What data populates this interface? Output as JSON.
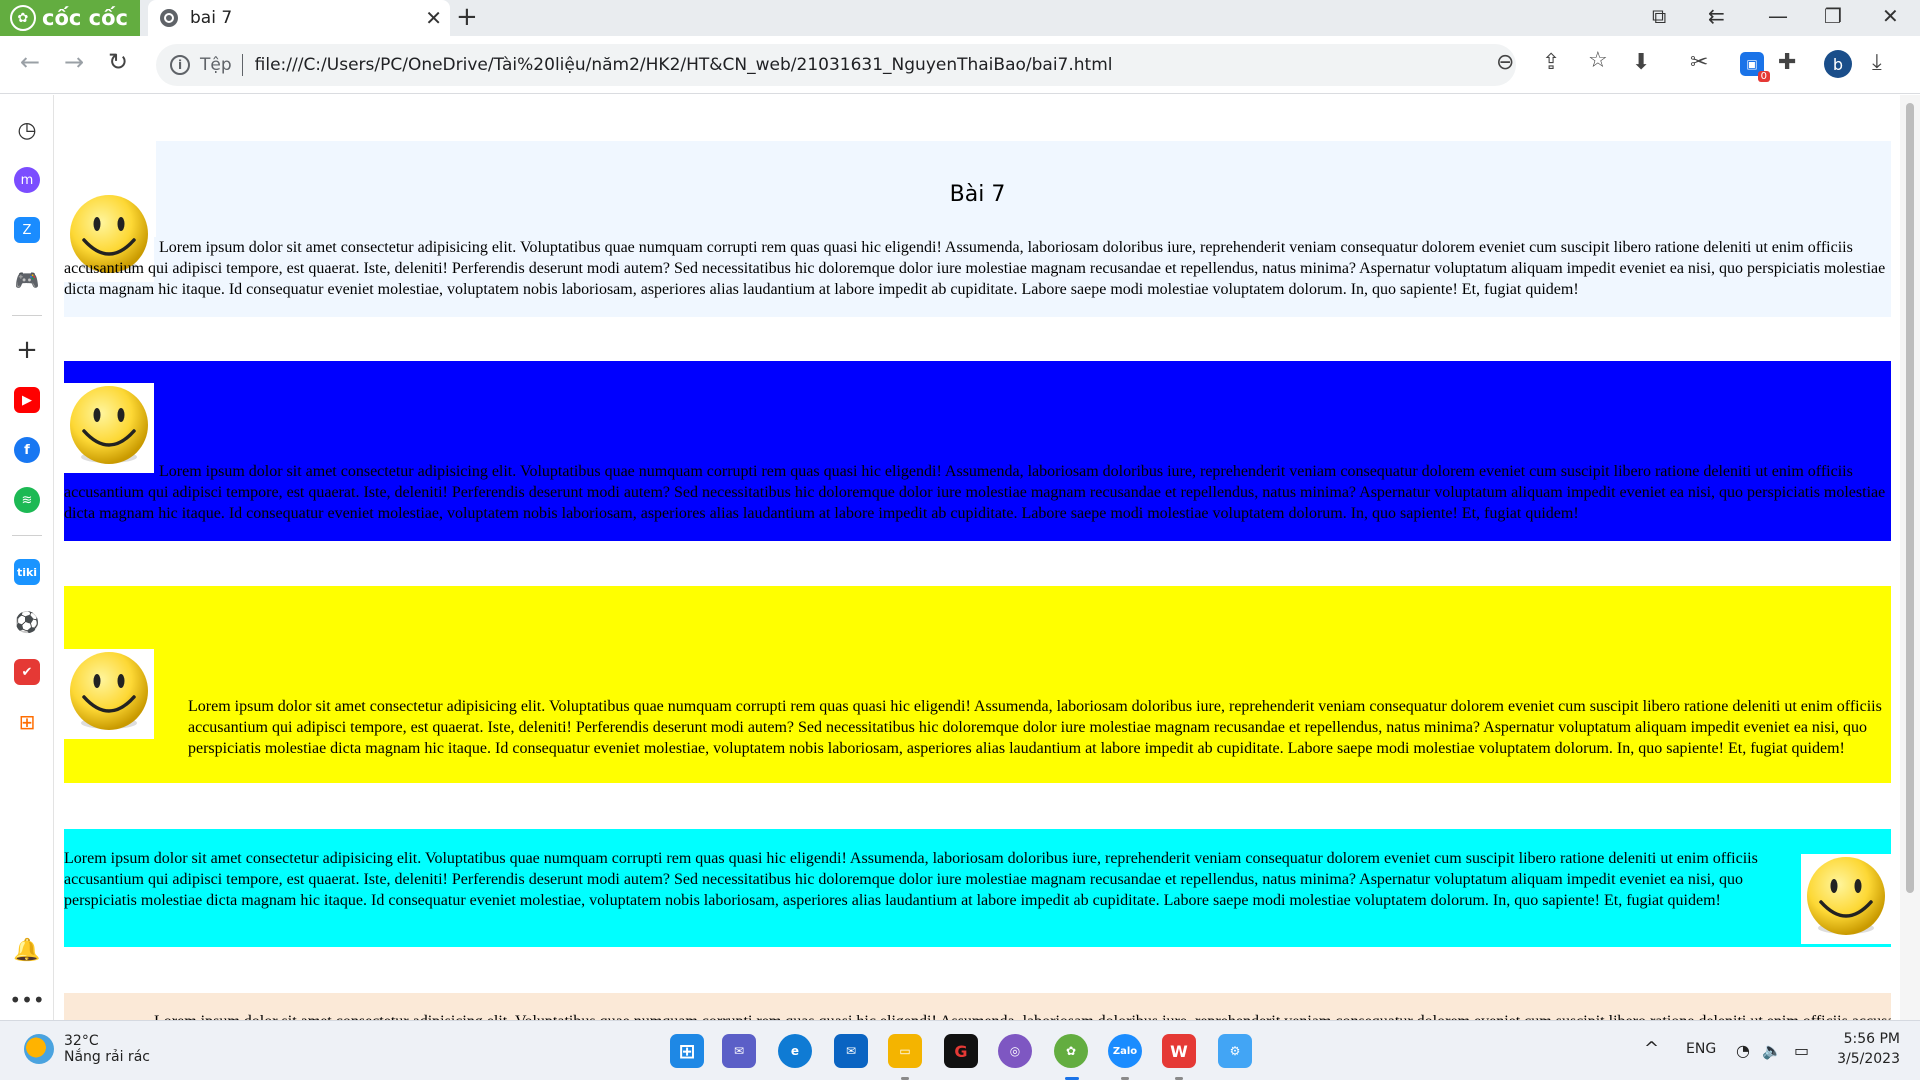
{
  "browser": {
    "brand": "cốc cốc",
    "tab_title": "bai 7",
    "address_scheme": "Tệp",
    "address_url": "file:///C:/Users/PC/OneDrive/Tài%20liệu/năm2/HK2/HT&CN_web/21031631_NguyenThaiBao/bai7.html",
    "avatar_letter": "b",
    "extension_badge": "0"
  },
  "page": {
    "title": "Bài 7",
    "lorem": "Lorem ipsum dolor sit amet consectetur adipisicing elit. Voluptatibus quae numquam corrupti rem quas quasi hic eligendi! Assumenda, laboriosam doloribus iure, reprehenderit veniam consequatur dolorem eveniet cum suscipit libero ratione deleniti ut enim officiis accusantium qui adipisci tempore, est quaerat. Iste, deleniti! Perferendis deserunt modi autem? Sed necessitatibus hic doloremque dolor iure molestiae magnam recusandae et repellendus, natus minima? Aspernatur voluptatum aliquam impedit eveniet ea nisi, quo perspiciatis molestiae dicta magnam hic itaque. Id consequatur eveniet molestiae, voluptatem nobis laboriosam, asperiores alias laudantium at labore impedit ab cupiditate. Labore saepe modi molestiae voluptatem dolorum. In, quo sapiente! Et, fugiat quidem!",
    "box_colors": [
      "#f0f7ff",
      "#0000ff",
      "#ffff00",
      "#00ffff",
      "#fbe9d7"
    ]
  },
  "taskbar": {
    "temperature": "32°C",
    "weather": "Nắng rải rác",
    "language": "ENG",
    "time": "5:56 PM",
    "date": "3/5/2023",
    "apps": [
      "windows-start",
      "teams-chat",
      "edge",
      "mail",
      "file-explorer",
      "garena",
      "copilot",
      "coccoc",
      "zalo",
      "wps-office",
      "chrome-remote"
    ]
  },
  "sidebar_icons": [
    "history-icon",
    "messenger-icon",
    "zalo-icon",
    "game-icon",
    "add-icon",
    "youtube-icon",
    "facebook-icon",
    "spotify-icon",
    "tiki-icon",
    "football-icon",
    "todo-icon",
    "shop-icon",
    "bell-icon",
    "more-icon"
  ]
}
